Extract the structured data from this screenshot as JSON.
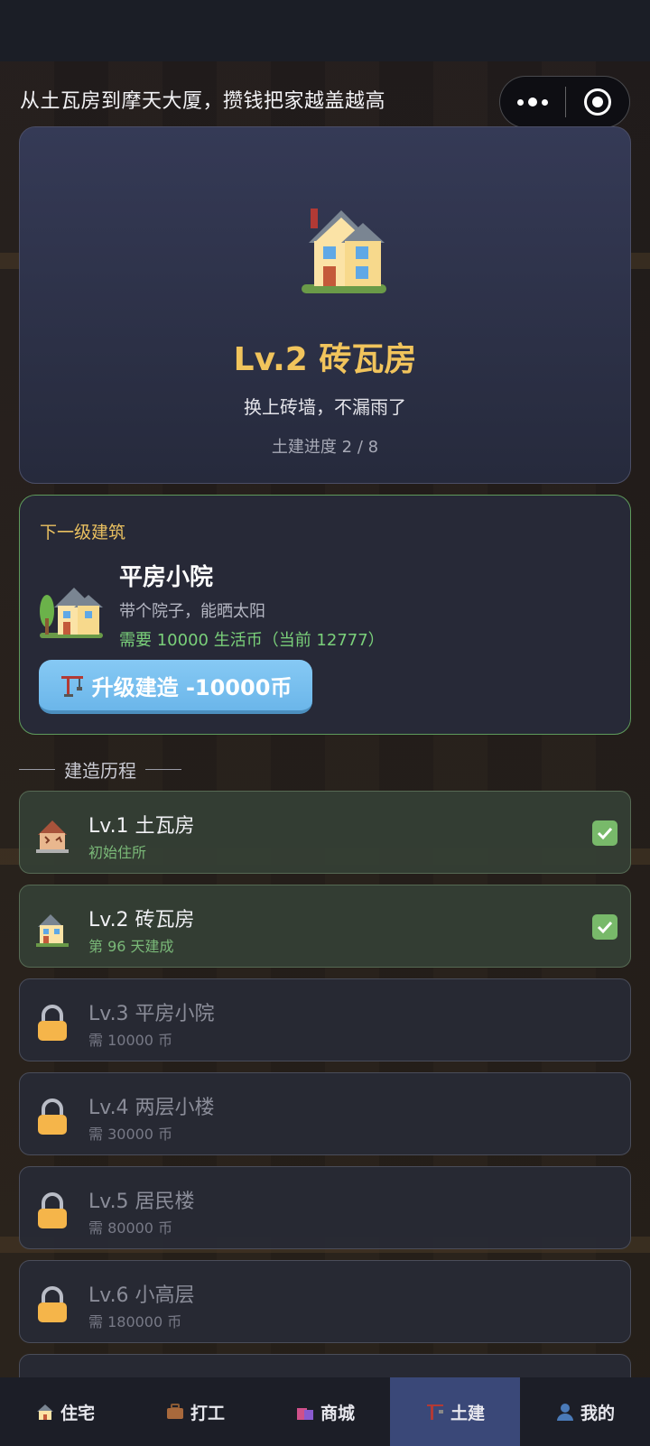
{
  "header": {
    "tagline": "从土瓦房到摩天大厦，攒钱把家越盖越高"
  },
  "current": {
    "level": "Lv.2 砖瓦房",
    "description": "换上砖墙，不漏雨了",
    "progress": "土建进度 2 / 8",
    "icon": "house-icon"
  },
  "next": {
    "section_title": "下一级建筑",
    "name": "平房小院",
    "description": "带个院子，能晒太阳",
    "cost_text": "需要 10000 生活币（当前 12777）",
    "button_label": "升级建造 -10000币",
    "icon": "house-with-garden-icon"
  },
  "history": {
    "title": "建造历程",
    "items": [
      {
        "name": "Lv.1 土瓦房",
        "sub": "初始住所",
        "status": "done",
        "icon": "derelict-house-icon"
      },
      {
        "name": "Lv.2 砖瓦房",
        "sub": "第 96 天建成",
        "status": "done",
        "icon": "house-icon"
      },
      {
        "name": "Lv.3 平房小院",
        "sub": "需 10000 币",
        "status": "locked",
        "icon": "lock-icon"
      },
      {
        "name": "Lv.4 两层小楼",
        "sub": "需 30000 币",
        "status": "locked",
        "icon": "lock-icon"
      },
      {
        "name": "Lv.5 居民楼",
        "sub": "需 80000 币",
        "status": "locked",
        "icon": "lock-icon"
      },
      {
        "name": "Lv.6 小高层",
        "sub": "需 180000 币",
        "status": "locked",
        "icon": "lock-icon"
      }
    ]
  },
  "tabs": [
    {
      "label": "住宅",
      "icon": "house-icon",
      "active": false
    },
    {
      "label": "打工",
      "icon": "briefcase-icon",
      "active": false
    },
    {
      "label": "商城",
      "icon": "shopping-bags-icon",
      "active": false
    },
    {
      "label": "土建",
      "icon": "construction-icon",
      "active": true
    },
    {
      "label": "我的",
      "icon": "user-icon",
      "active": false
    }
  ],
  "colors": {
    "accent_gold": "#f1c45c",
    "success_green": "#7ad07a",
    "button_blue": "#6bb6ea",
    "active_tab": "#3a4878"
  }
}
